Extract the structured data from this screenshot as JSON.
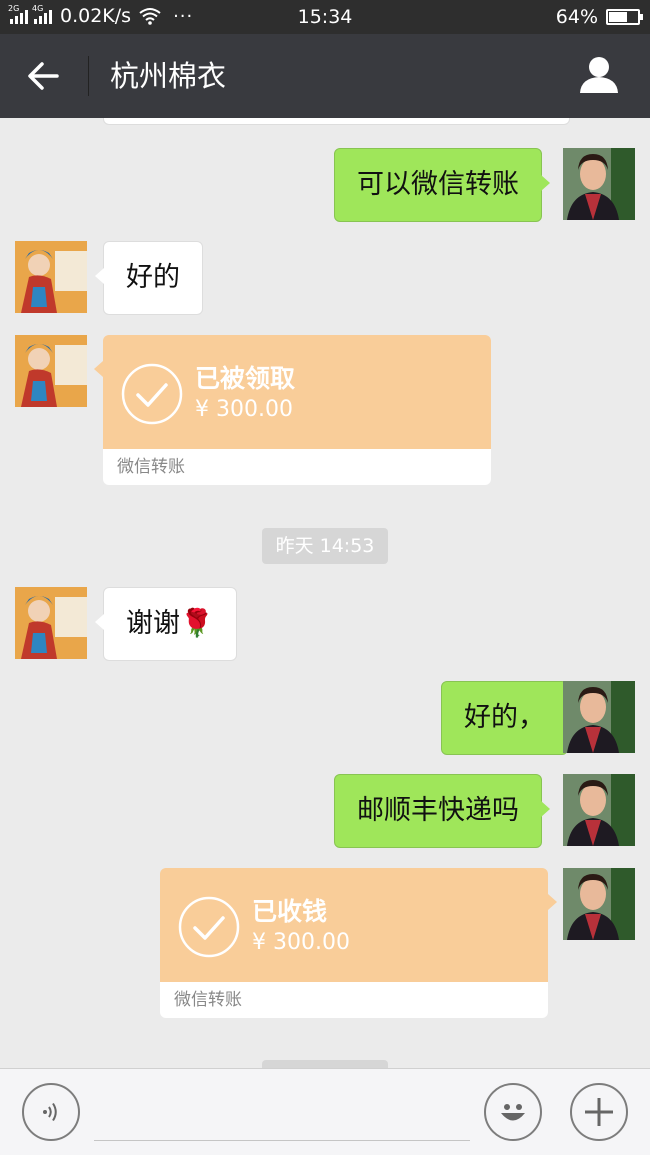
{
  "status_bar": {
    "net_type_1": "2G",
    "net_type_2": "4G",
    "speed": "0.02K/s",
    "more": "···",
    "time": "15:34",
    "battery_text": "64%",
    "battery_level": 0.64
  },
  "header": {
    "title": "杭州棉衣",
    "back_icon": "back-arrow-icon",
    "profile_icon": "person-icon"
  },
  "messages": [
    {
      "side": "right",
      "type": "text",
      "text": "可以微信转账"
    },
    {
      "side": "left",
      "type": "text",
      "text": "好的"
    },
    {
      "side": "left",
      "type": "transfer",
      "title": "已被领取",
      "amount": "¥ 300.00",
      "footer": "微信转账"
    },
    {
      "side": "left",
      "type": "text",
      "text": "谢谢🌹"
    },
    {
      "side": "right",
      "type": "text",
      "text": "好的，"
    },
    {
      "side": "right",
      "type": "text",
      "text": "邮顺丰快递吗"
    },
    {
      "side": "right",
      "type": "transfer",
      "title": "已收钱",
      "amount": "¥ 300.00",
      "footer": "微信转账"
    }
  ],
  "timestamp": "昨天 14:53",
  "input_bar": {
    "voice_icon": "voice-icon",
    "emoji_icon": "emoji-icon",
    "plus_icon": "plus-icon",
    "placeholder": ""
  },
  "colors": {
    "my_bubble": "#9fe65a",
    "their_bubble": "#ffffff",
    "transfer": "#f9cd99",
    "nav_bg": "#393a3f"
  }
}
